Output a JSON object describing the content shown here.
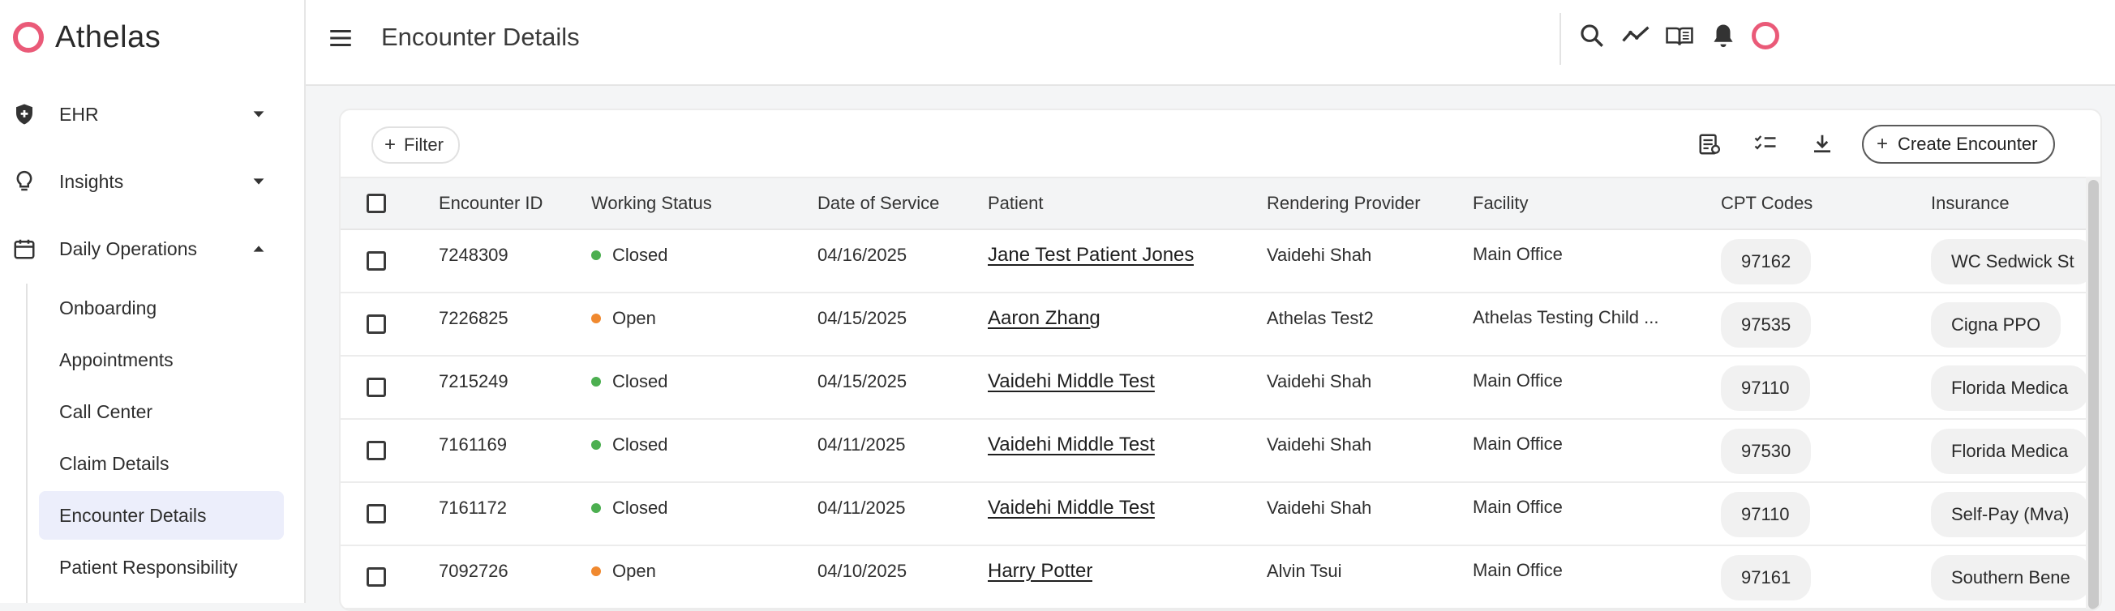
{
  "app": {
    "name": "Athelas"
  },
  "colors": {
    "brand": "#ea5a78",
    "status_closed": "#4caf50",
    "status_open": "#f0892f",
    "active_nav_bg": "#eceefb"
  },
  "sidebar": {
    "sections": [
      {
        "label": "EHR",
        "icon": "shield-plus-icon",
        "expanded": false
      },
      {
        "label": "Insights",
        "icon": "lightbulb-icon",
        "expanded": false
      },
      {
        "label": "Daily Operations",
        "icon": "calendar-icon",
        "expanded": true
      }
    ],
    "sub_items": [
      {
        "label": "Onboarding"
      },
      {
        "label": "Appointments"
      },
      {
        "label": "Call Center"
      },
      {
        "label": "Claim Details"
      },
      {
        "label": "Encounter Details",
        "active": true
      },
      {
        "label": "Patient Responsibility"
      }
    ]
  },
  "header": {
    "title": "Encounter Details",
    "icons": [
      "search-icon",
      "trend-icon",
      "book-icon",
      "bell-icon",
      "profile-avatar"
    ]
  },
  "toolbar": {
    "filter_label": "Filter",
    "icons": [
      "report-icon",
      "checklist-icon",
      "download-icon"
    ],
    "create_label": "Create Encounter"
  },
  "table": {
    "columns": [
      "Encounter ID",
      "Working Status",
      "Date of Service",
      "Patient",
      "Rendering Provider",
      "Facility",
      "CPT Codes",
      "Insurance"
    ],
    "rows": [
      {
        "id": "7248309",
        "status": "Closed",
        "date": "04/16/2025",
        "patient": "Jane Test Patient Jones",
        "provider": "Vaidehi Shah",
        "facility": "Main Office",
        "cpt": "97162",
        "insurance": "WC Sedwick St"
      },
      {
        "id": "7226825",
        "status": "Open",
        "date": "04/15/2025",
        "patient": "Aaron Zhang",
        "provider": "Athelas Test2",
        "facility": "Athelas Testing Child ...",
        "cpt": "97535",
        "insurance": "Cigna PPO"
      },
      {
        "id": "7215249",
        "status": "Closed",
        "date": "04/15/2025",
        "patient": "Vaidehi Middle Test",
        "provider": "Vaidehi Shah",
        "facility": "Main Office",
        "cpt": "97110",
        "insurance": "Florida Medica"
      },
      {
        "id": "7161169",
        "status": "Closed",
        "date": "04/11/2025",
        "patient": "Vaidehi Middle Test",
        "provider": "Vaidehi Shah",
        "facility": "Main Office",
        "cpt": "97530",
        "insurance": "Florida Medica"
      },
      {
        "id": "7161172",
        "status": "Closed",
        "date": "04/11/2025",
        "patient": "Vaidehi Middle Test",
        "provider": "Vaidehi Shah",
        "facility": "Main Office",
        "cpt": "97110",
        "insurance": "Self-Pay (Mva)"
      },
      {
        "id": "7092726",
        "status": "Open",
        "date": "04/10/2025",
        "patient": "Harry Potter",
        "provider": "Alvin Tsui",
        "facility": "Main Office",
        "cpt": "97161",
        "insurance": "Southern Bene"
      }
    ]
  }
}
